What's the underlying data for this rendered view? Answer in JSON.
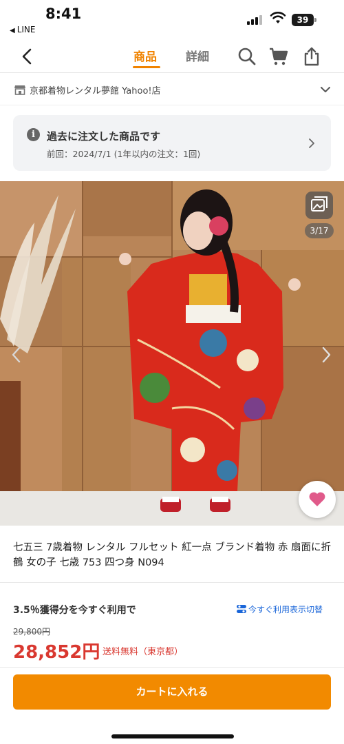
{
  "status_bar": {
    "time": "8:41",
    "back_app": "LINE",
    "battery": "39"
  },
  "nav": {
    "tabs": [
      {
        "label": "商品",
        "active": true
      },
      {
        "label": "詳細",
        "active": false
      }
    ],
    "icons": [
      "back-icon",
      "search-icon",
      "cart-icon",
      "share-icon"
    ],
    "accent_color": "#f08300"
  },
  "store": {
    "name": "京都着物レンタル夢館 Yahoo!店"
  },
  "order_history": {
    "title": "過去に注文した商品です",
    "subtitle": "前回：2024/7/1 (1年以内の注文：1回)"
  },
  "gallery": {
    "counter": "3/17"
  },
  "product": {
    "title": "七五三 7歳着物 レンタル フルセット 紅一点 ブランド着物 赤 扇面に折鶴 女の子 七歳 753 四つ身 N094"
  },
  "pricing": {
    "points_text": "3.5％獲得分を今すぐ利用で",
    "toggle_label": "今すぐ利用表示切替",
    "original_price": "29,800円",
    "price": "28,852円",
    "shipping": "送料無料（東京都）",
    "price_color": "#d93830"
  },
  "cart": {
    "button_label": "カートに入れる",
    "button_color": "#f28a00"
  }
}
